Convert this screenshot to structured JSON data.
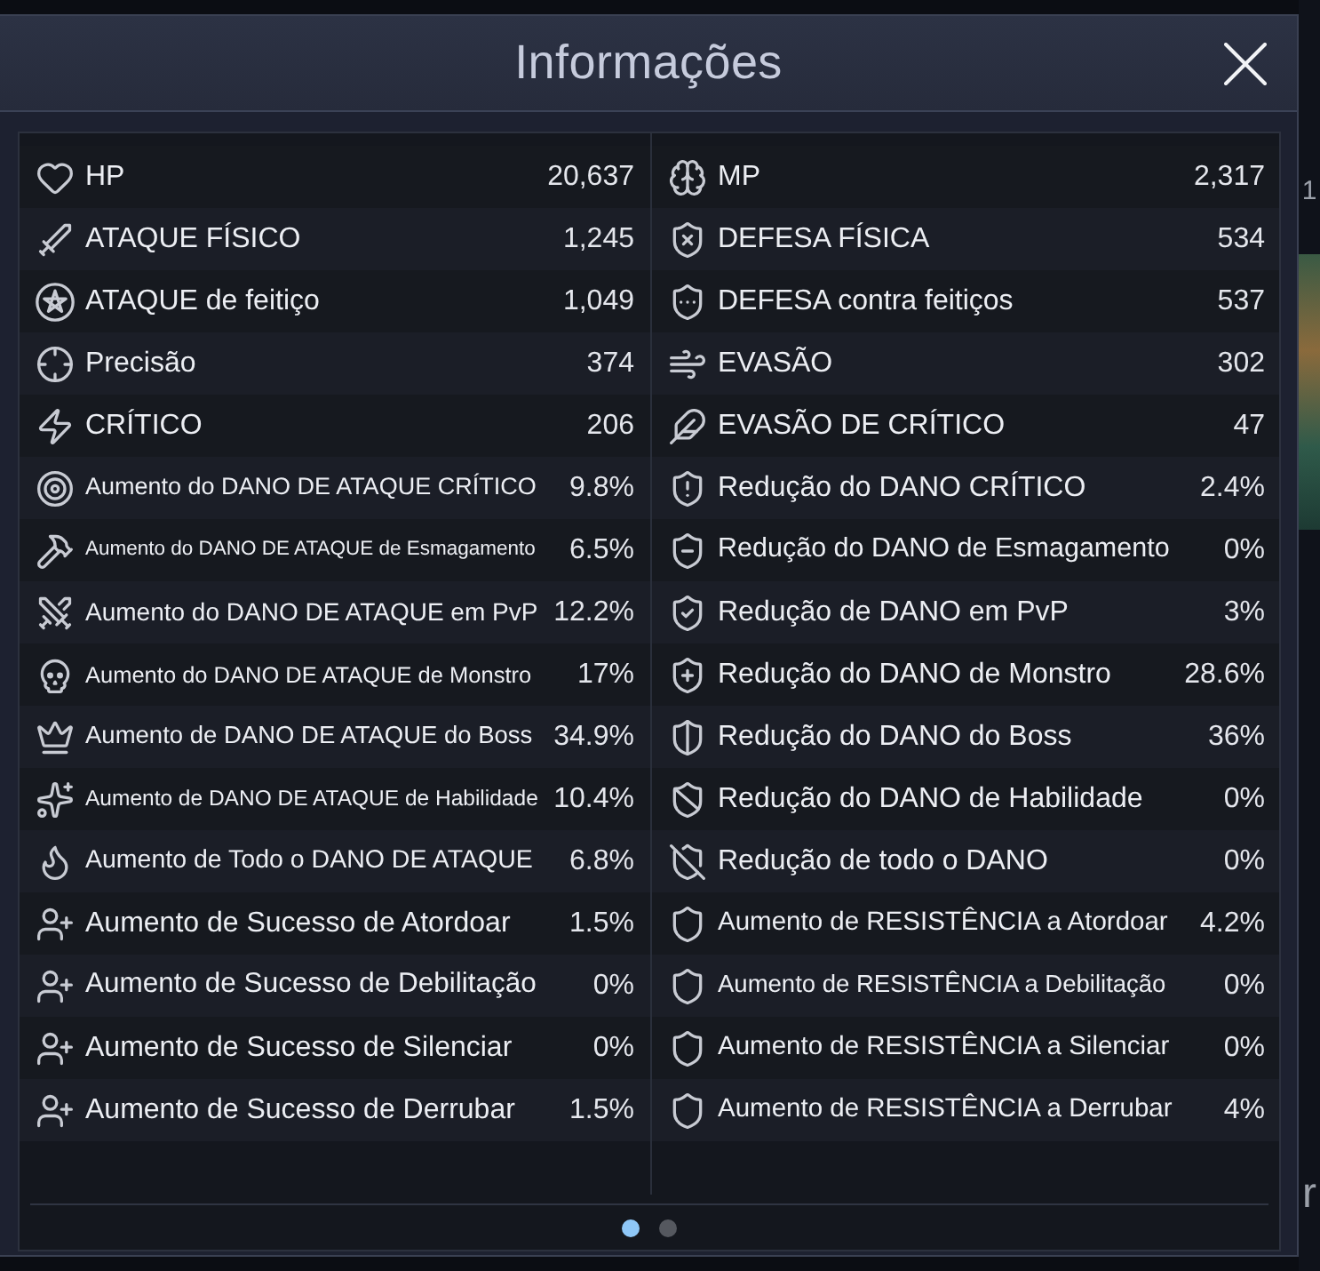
{
  "window": {
    "title": "Informações"
  },
  "stats": {
    "left": [
      {
        "label": "HP",
        "value": "20,637"
      },
      {
        "label": "ATAQUE FÍSICO",
        "value": "1,245"
      },
      {
        "label": "ATAQUE de feitiço",
        "value": "1,049"
      },
      {
        "label": "Precisão",
        "value": "374"
      },
      {
        "label": "CRÍTICO",
        "value": "206"
      },
      {
        "label": "Aumento do DANO DE ATAQUE CRÍTICO",
        "value": "9.8%"
      },
      {
        "label": "Aumento do DANO DE ATAQUE de Esmagamento",
        "value": "6.5%"
      },
      {
        "label": "Aumento do DANO DE ATAQUE em PvP",
        "value": "12.2%"
      },
      {
        "label": "Aumento do DANO DE ATAQUE de Monstro",
        "value": "17%"
      },
      {
        "label": "Aumento de DANO DE ATAQUE do Boss",
        "value": "34.9%"
      },
      {
        "label": "Aumento de DANO DE ATAQUE de Habilidade",
        "value": "10.4%"
      },
      {
        "label": "Aumento de Todo o DANO DE ATAQUE",
        "value": "6.8%"
      },
      {
        "label": "Aumento de Sucesso de Atordoar",
        "value": "1.5%"
      },
      {
        "label": "Aumento de Sucesso de Debilitação",
        "value": "0%"
      },
      {
        "label": "Aumento de Sucesso de Silenciar",
        "value": "0%"
      },
      {
        "label": "Aumento de Sucesso de Derrubar",
        "value": "1.5%"
      }
    ],
    "right": [
      {
        "label": "MP",
        "value": "2,317"
      },
      {
        "label": "DEFESA FÍSICA",
        "value": "534"
      },
      {
        "label": "DEFESA contra feitiços",
        "value": "537"
      },
      {
        "label": "EVASÃO",
        "value": "302"
      },
      {
        "label": "EVASÃO DE CRÍTICO",
        "value": "47"
      },
      {
        "label": "Redução do DANO CRÍTICO",
        "value": "2.4%"
      },
      {
        "label": "Redução do DANO de Esmagamento",
        "value": "0%"
      },
      {
        "label": "Redução de DANO em PvP",
        "value": "3%"
      },
      {
        "label": "Redução do DANO de Monstro",
        "value": "28.6%"
      },
      {
        "label": "Redução do DANO do Boss",
        "value": "36%"
      },
      {
        "label": "Redução do DANO de Habilidade",
        "value": "0%"
      },
      {
        "label": "Redução de todo o DANO",
        "value": "0%"
      },
      {
        "label": "Aumento de RESISTÊNCIA a Atordoar",
        "value": "4.2%"
      },
      {
        "label": "Aumento de RESISTÊNCIA a Debilitação",
        "value": "0%"
      },
      {
        "label": "Aumento de RESISTÊNCIA a Silenciar",
        "value": "0%"
      },
      {
        "label": "Aumento de RESISTÊNCIA a Derrubar",
        "value": "4%"
      }
    ]
  },
  "pagination": [
    {
      "selected": true
    },
    {
      "selected": false
    }
  ],
  "backdrop": {
    "texts": [
      "1",
      "r"
    ]
  }
}
